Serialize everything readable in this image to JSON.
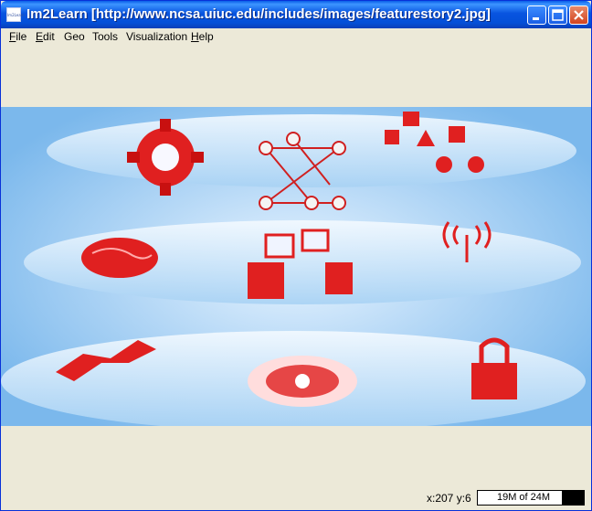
{
  "window": {
    "title": "Im2Learn [http://www.ncsa.uiuc.edu/includes/images/featurestory2.jpg]",
    "app_icon_text": "Im2Learn"
  },
  "menu": {
    "items": [
      {
        "label": "File",
        "mnemonic": "F",
        "rest": "ile"
      },
      {
        "label": "Edit",
        "mnemonic": "E",
        "rest": "dit"
      },
      {
        "label": "Geo",
        "mnemonic": "",
        "rest": "Geo"
      },
      {
        "label": "Tools",
        "mnemonic": "",
        "rest": "Tools"
      },
      {
        "label": "Visualization",
        "mnemonic": "",
        "rest": "Visualization"
      },
      {
        "label": "Help",
        "mnemonic": "H",
        "rest": "elp"
      }
    ]
  },
  "status": {
    "coords": "x:207 y:6",
    "memory_label": "19M of 24M",
    "memory_used_fraction": 0.79
  },
  "image": {
    "description_icons": [
      "gear-icon",
      "network-icon",
      "flowchart-icon",
      "brain-icon",
      "monitors-icon",
      "wireless-icon",
      "path-icon",
      "radial-icon",
      "lock-icon"
    ],
    "accent": "#e02020"
  }
}
